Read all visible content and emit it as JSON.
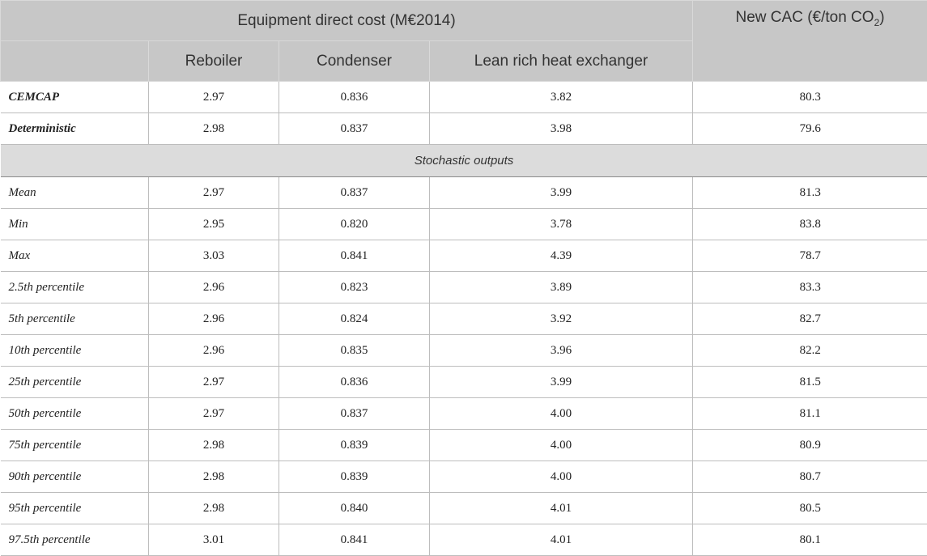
{
  "header": {
    "group_title": "Equipment direct cost (M€2014)",
    "new_cac_prefix": "New CAC (€/ton CO",
    "new_cac_sub": "2",
    "new_cac_suffix": ")",
    "columns": [
      "Reboiler",
      "Condenser",
      "Lean rich heat exchanger"
    ]
  },
  "reference_rows": [
    {
      "label": "CEMCAP",
      "values": [
        "2.97",
        "0.836",
        "3.82",
        "80.3"
      ]
    },
    {
      "label": "Deterministic",
      "values": [
        "2.98",
        "0.837",
        "3.98",
        "79.6"
      ]
    }
  ],
  "section_label": "Stochastic outputs",
  "stochastic_rows": [
    {
      "label": "Mean",
      "values": [
        "2.97",
        "0.837",
        "3.99",
        "81.3"
      ]
    },
    {
      "label": "Min",
      "values": [
        "2.95",
        "0.820",
        "3.78",
        "83.8"
      ]
    },
    {
      "label": "Max",
      "values": [
        "3.03",
        "0.841",
        "4.39",
        "78.7"
      ]
    },
    {
      "label": "2.5th percentile",
      "values": [
        "2.96",
        "0.823",
        "3.89",
        "83.3"
      ]
    },
    {
      "label": "5th percentile",
      "values": [
        "2.96",
        "0.824",
        "3.92",
        "82.7"
      ]
    },
    {
      "label": "10th percentile",
      "values": [
        "2.96",
        "0.835",
        "3.96",
        "82.2"
      ]
    },
    {
      "label": "25th percentile",
      "values": [
        "2.97",
        "0.836",
        "3.99",
        "81.5"
      ]
    },
    {
      "label": "50th percentile",
      "values": [
        "2.97",
        "0.837",
        "4.00",
        "81.1"
      ]
    },
    {
      "label": "75th percentile",
      "values": [
        "2.98",
        "0.839",
        "4.00",
        "80.9"
      ]
    },
    {
      "label": "90th percentile",
      "values": [
        "2.98",
        "0.839",
        "4.00",
        "80.7"
      ]
    },
    {
      "label": "95th percentile",
      "values": [
        "2.98",
        "0.840",
        "4.01",
        "80.5"
      ]
    },
    {
      "label": "97.5th percentile",
      "values": [
        "3.01",
        "0.841",
        "4.01",
        "80.1"
      ]
    }
  ]
}
